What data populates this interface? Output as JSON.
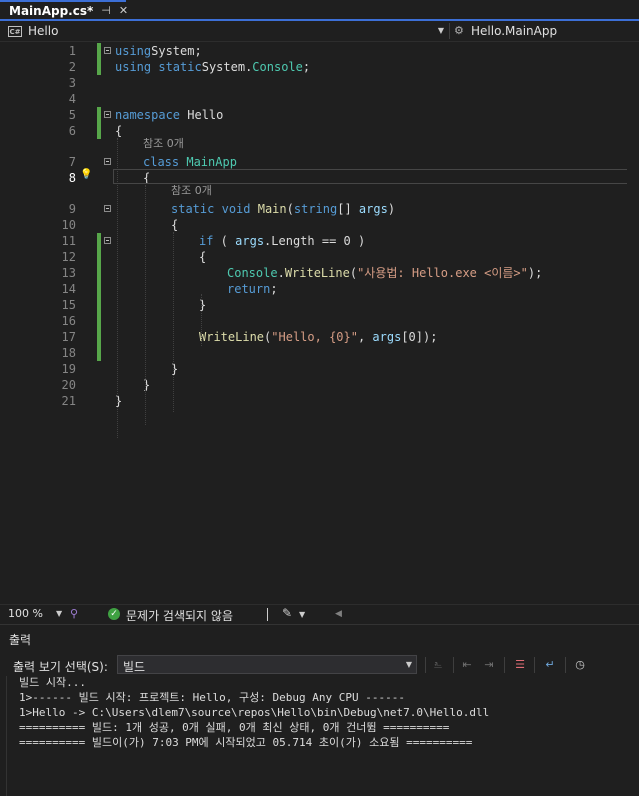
{
  "tab": {
    "title": "MainApp.cs*",
    "pin_glyph": "⊣",
    "close_glyph": "✕"
  },
  "nav": {
    "project": "Hello",
    "member": "Hello.MainApp",
    "lang_badge": "C#"
  },
  "editor": {
    "current_line": 8,
    "ref_text": "참조 0개",
    "lines": [
      {
        "n": "1",
        "code": [
          [
            "kw",
            "using"
          ],
          [
            "",
            "System;"
          ]
        ]
      },
      {
        "n": "2",
        "code": [
          [
            "kw",
            "using"
          ],
          [
            "",
            ""
          ],
          [
            "kw",
            "static"
          ],
          [
            "",
            "System."
          ],
          [
            "ty",
            "Console"
          ],
          [
            "",
            ";"
          ]
        ]
      },
      {
        "n": "3",
        "code": []
      },
      {
        "n": "4",
        "code": []
      },
      {
        "n": "5",
        "code": [
          [
            "kw",
            "namespace"
          ],
          [
            "",
            " Hello"
          ]
        ]
      },
      {
        "n": "6",
        "code": [
          [
            "",
            "{"
          ]
        ]
      },
      {
        "n": "7",
        "code": [
          [
            "kw",
            "class"
          ],
          [
            "",
            " "
          ],
          [
            "ty",
            "MainApp"
          ]
        ]
      },
      {
        "n": "8",
        "code": [
          [
            "",
            "{"
          ]
        ]
      },
      {
        "n": "9",
        "code": [
          [
            "kw",
            "static"
          ],
          [
            "",
            " "
          ],
          [
            "kw",
            "void"
          ],
          [
            "",
            " "
          ],
          [
            "fn",
            "Main"
          ],
          [
            "",
            "("
          ],
          [
            "kw",
            "string"
          ],
          [
            "",
            "[] "
          ],
          [
            "par",
            "args"
          ],
          [
            "",
            ")"
          ]
        ]
      },
      {
        "n": "10",
        "code": [
          [
            "",
            "{"
          ]
        ]
      },
      {
        "n": "11",
        "code": [
          [
            "kw",
            "if"
          ],
          [
            "",
            " ( "
          ],
          [
            "par",
            "args"
          ],
          [
            "",
            ".Length == 0 )"
          ]
        ]
      },
      {
        "n": "12",
        "code": [
          [
            "",
            "{"
          ]
        ]
      },
      {
        "n": "13",
        "code": [
          [
            "ty",
            "Console"
          ],
          [
            "",
            "."
          ],
          [
            "fn",
            "WriteLine"
          ],
          [
            "",
            "("
          ],
          [
            "str",
            "\"사용법: Hello.exe <이름>\""
          ],
          [
            "",
            ");"
          ]
        ]
      },
      {
        "n": "14",
        "code": [
          [
            "kw",
            "return"
          ],
          [
            "",
            ";"
          ]
        ]
      },
      {
        "n": "15",
        "code": [
          [
            "",
            "}"
          ]
        ]
      },
      {
        "n": "16",
        "code": []
      },
      {
        "n": "17",
        "code": [
          [
            "fn",
            "WriteLine"
          ],
          [
            "",
            "("
          ],
          [
            "str",
            "\"Hello, {0}\""
          ],
          [
            "",
            ", "
          ],
          [
            "par",
            "args"
          ],
          [
            "",
            "[0]);"
          ]
        ]
      },
      {
        "n": "18",
        "code": []
      },
      {
        "n": "19",
        "code": [
          [
            "",
            "}"
          ]
        ]
      },
      {
        "n": "20",
        "code": [
          [
            "",
            "}"
          ]
        ]
      },
      {
        "n": "21",
        "code": [
          [
            "",
            "}"
          ]
        ]
      }
    ]
  },
  "status": {
    "zoom": "100 %",
    "issues": "문제가 검색되지 않음"
  },
  "output": {
    "title": "출력",
    "source_label": "출력 보기 선택(S):",
    "source_value": "빌드",
    "lines": [
      "빌드 시작...",
      "1>------ 빌드 시작: 프로젝트: Hello, 구성: Debug Any CPU ------",
      "1>Hello -> C:\\Users\\dlem7\\source\\repos\\Hello\\bin\\Debug\\net7.0\\Hello.dll",
      "========== 빌드: 1개 성공, 0개 실패, 0개 최신 상태, 0개 건너뜀 ==========",
      "========== 빌드이(가) 7:03 PM에 시작되었고 05.714 초이(가) 소요됨 =========="
    ]
  },
  "colors": {
    "accent": "#3c6fd6",
    "changed": "#57a64a",
    "keyword": "#569cd6",
    "type": "#4ec9b0",
    "string": "#d69d85"
  }
}
